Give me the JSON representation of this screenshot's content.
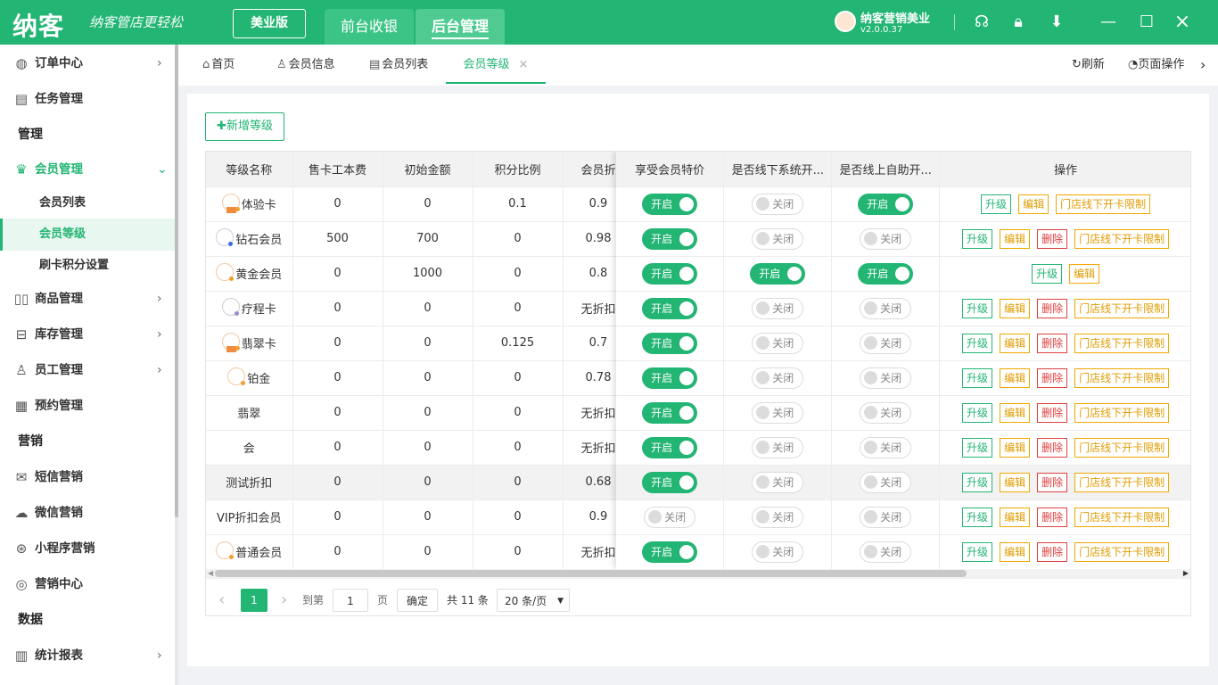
{
  "app": {
    "logo": "纳客",
    "slogan": "纳客管店更轻松",
    "edition": "美业版",
    "nav_tabs": [
      "前台收银",
      "后台管理"
    ],
    "user_name": "纳客营销美业",
    "version": "v2.0.0.37"
  },
  "window_icons": {
    "support": "headset-icon",
    "lock": "lock-icon",
    "download": "download-icon",
    "minimize": "minimize-icon",
    "maximize": "maximize-icon",
    "close": "close-icon"
  },
  "sidebar": {
    "items": [
      {
        "label": "订单中心",
        "icon": "globe-icon",
        "arrow": "›"
      },
      {
        "label": "任务管理",
        "icon": "task-icon"
      },
      {
        "label": "管理"
      },
      {
        "label": "会员管理",
        "icon": "crown-icon",
        "arrow": "⌄"
      },
      {
        "label": "会员列表"
      },
      {
        "label": "会员等级"
      },
      {
        "label": "刷卡积分设置"
      },
      {
        "label": "商品管理",
        "icon": "goods-icon",
        "arrow": "›"
      },
      {
        "label": "库存管理",
        "icon": "inventory-icon",
        "arrow": "›"
      },
      {
        "label": "员工管理",
        "icon": "staff-icon",
        "arrow": "›"
      },
      {
        "label": "预约管理",
        "icon": "calendar-icon"
      },
      {
        "label": "营销"
      },
      {
        "label": "短信营销",
        "icon": "mail-icon"
      },
      {
        "label": "微信营销",
        "icon": "wechat-icon"
      },
      {
        "label": "小程序营销",
        "icon": "miniprogram-icon"
      },
      {
        "label": "营销中心",
        "icon": "target-icon"
      },
      {
        "label": "数据"
      },
      {
        "label": "统计报表",
        "icon": "chart-icon",
        "arrow": "›"
      }
    ]
  },
  "page_tabs": [
    {
      "label": "首页",
      "icon": "home-icon"
    },
    {
      "label": "会员信息",
      "icon": "user-icon"
    },
    {
      "label": "会员列表",
      "icon": "list-icon"
    },
    {
      "label": "会员等级",
      "close": "×"
    }
  ],
  "tab_actions": {
    "refresh": "刷新",
    "page_ops": "页面操作",
    "more": "›"
  },
  "main": {
    "add_button": "新增等级",
    "columns": [
      "等级名称",
      "售卡工本费",
      "初始金额",
      "积分比例",
      "会员折",
      "享受会员特价",
      "是否线下系统开...",
      "是否线上自助开...",
      "操作"
    ],
    "rows": [
      {
        "name": "体验卡",
        "fee": "0",
        "init": "0",
        "ratio": "0.1",
        "discount": "0.9",
        "special": "开启",
        "offline": "关闭",
        "online": "开启",
        "ops": [
          "升级",
          "编辑",
          "门店线下开卡限制"
        ]
      },
      {
        "name": "钻石会员",
        "fee": "500",
        "init": "700",
        "ratio": "0",
        "discount": "0.98",
        "special": "开启",
        "offline": "关闭",
        "online": "关闭",
        "ops": [
          "升级",
          "编辑",
          "删除",
          "门店线下开卡限制"
        ]
      },
      {
        "name": "黄金会员",
        "fee": "0",
        "init": "1000",
        "ratio": "0",
        "discount": "0.8",
        "special": "开启",
        "offline": "开启",
        "online": "开启",
        "ops": [
          "升级",
          "编辑"
        ]
      },
      {
        "name": "疗程卡",
        "fee": "0",
        "init": "0",
        "ratio": "0",
        "discount": "无折扣",
        "special": "开启",
        "offline": "关闭",
        "online": "关闭",
        "ops": [
          "升级",
          "编辑",
          "删除",
          "门店线下开卡限制"
        ]
      },
      {
        "name": "翡翠卡",
        "fee": "0",
        "init": "0",
        "ratio": "0.125",
        "discount": "0.7",
        "special": "开启",
        "offline": "关闭",
        "online": "关闭",
        "ops": [
          "升级",
          "编辑",
          "删除",
          "门店线下开卡限制"
        ]
      },
      {
        "name": "铂金",
        "fee": "0",
        "init": "0",
        "ratio": "0",
        "discount": "0.78",
        "special": "开启",
        "offline": "关闭",
        "online": "关闭",
        "ops": [
          "升级",
          "编辑",
          "删除",
          "门店线下开卡限制"
        ]
      },
      {
        "name": "翡翠",
        "fee": "0",
        "init": "0",
        "ratio": "0",
        "discount": "无折扣",
        "special": "开启",
        "offline": "关闭",
        "online": "关闭",
        "ops": [
          "升级",
          "编辑",
          "删除",
          "门店线下开卡限制"
        ]
      },
      {
        "name": "会",
        "fee": "0",
        "init": "0",
        "ratio": "0",
        "discount": "无折扣",
        "special": "开启",
        "offline": "关闭",
        "online": "关闭",
        "ops": [
          "升级",
          "编辑",
          "删除",
          "门店线下开卡限制"
        ]
      },
      {
        "name": "测试折扣",
        "fee": "0",
        "init": "0",
        "ratio": "0",
        "discount": "0.68",
        "special": "开启",
        "offline": "关闭",
        "online": "关闭",
        "ops": [
          "升级",
          "编辑",
          "删除",
          "门店线下开卡限制"
        ]
      },
      {
        "name": "VIP折扣会员",
        "fee": "0",
        "init": "0",
        "ratio": "0",
        "discount": "0.9",
        "special": "关闭",
        "offline": "关闭",
        "online": "关闭",
        "ops": [
          "升级",
          "编辑",
          "删除",
          "门店线下开卡限制"
        ]
      },
      {
        "name": "普通会员",
        "fee": "0",
        "init": "0",
        "ratio": "0",
        "discount": "无折扣",
        "special": "开启",
        "offline": "关闭",
        "online": "关闭",
        "ops": [
          "升级",
          "编辑",
          "删除",
          "门店线下开卡限制"
        ]
      }
    ],
    "pager": {
      "prev": "‹",
      "current": "1",
      "next": "›",
      "goto_label": "到第",
      "goto_value": "1",
      "page_unit": "页",
      "confirm": "确定",
      "total": "共 11 条",
      "page_size": "20 条/页"
    }
  },
  "colors": {
    "accent": "#22b573",
    "warning": "#f0a800",
    "danger": "#e04040"
  }
}
